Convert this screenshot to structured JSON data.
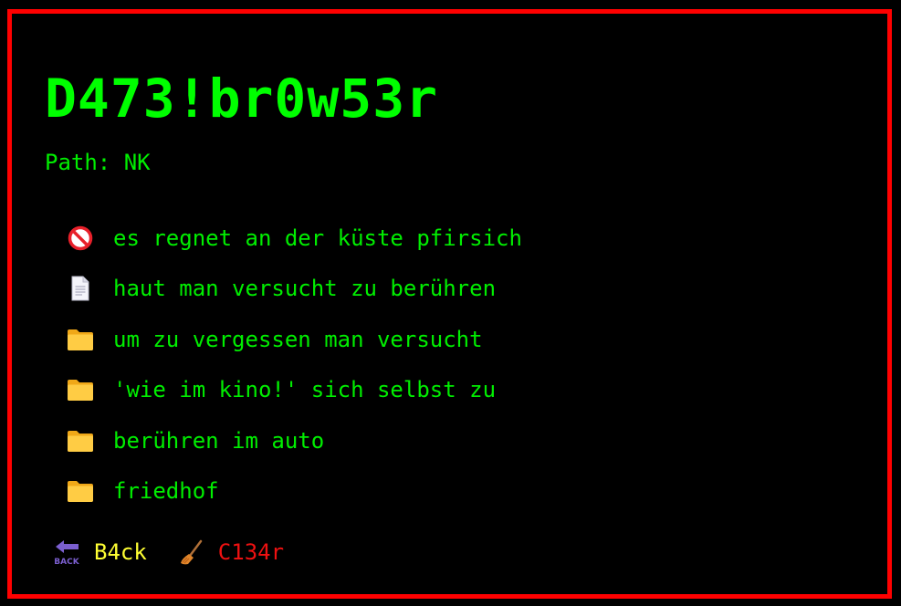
{
  "app": {
    "title": "D473!br0w53r"
  },
  "path": {
    "text": "Path: NK"
  },
  "entries": [
    {
      "icon": "no-entry-icon",
      "label": "es regnet an der küste pfirsich"
    },
    {
      "icon": "document-icon",
      "label": "haut man versucht zu berühren"
    },
    {
      "icon": "folder-icon",
      "label": "um zu vergessen man versucht"
    },
    {
      "icon": "folder-icon",
      "label": "'wie im kino!' sich selbst zu"
    },
    {
      "icon": "folder-icon",
      "label": "berühren im auto"
    },
    {
      "icon": "folder-icon",
      "label": "friedhof"
    }
  ],
  "controls": {
    "back_label": "B4ck",
    "back_icon_text": "BACK",
    "clear_label": "C134r"
  },
  "colors": {
    "border": "#ff0000",
    "background": "#000000",
    "text": "#00ee00",
    "back": "#ffff33",
    "clear": "#ee1111",
    "folder": "#ffcc44"
  }
}
